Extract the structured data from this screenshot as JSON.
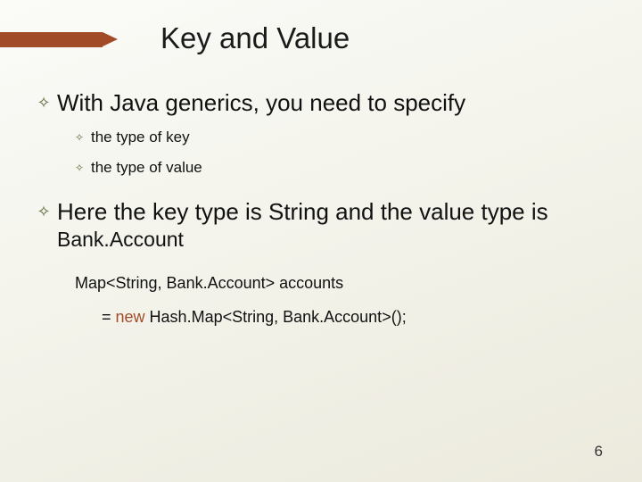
{
  "title": "Key and Value",
  "bullets": {
    "p1": "With Java generics, you need to specify",
    "p1_sub1": "the type of key",
    "p1_sub2": "the type of value",
    "p2_a": "Here the key type is String and the value type is ",
    "p2_b": "Bank.Account"
  },
  "code": {
    "line1": "Map<String, Bank.Account> accounts",
    "line2_a": "= ",
    "line2_new": "new",
    "line2_b": " Hash.Map<String, Bank.Account>();"
  },
  "pageNumber": "6",
  "glyphs": {
    "diamond": "✧"
  }
}
